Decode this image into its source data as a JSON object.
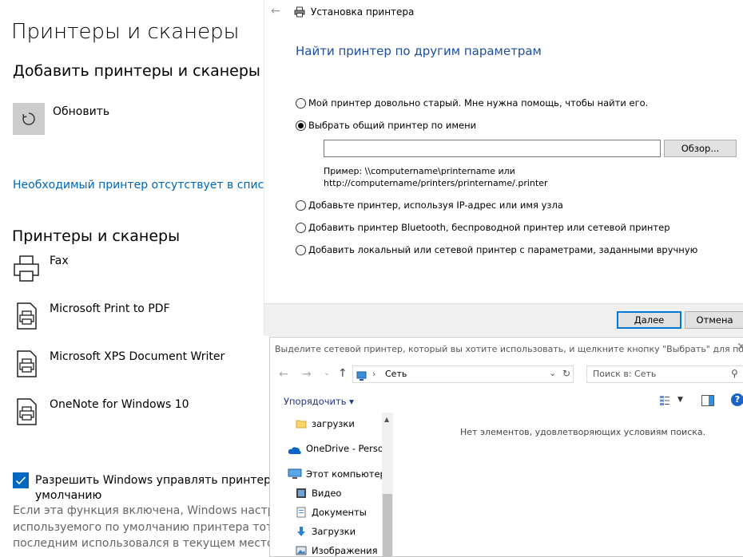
{
  "settings": {
    "title": "Принтеры и сканеры",
    "add_heading": "Добавить принтеры и сканеры",
    "refresh_label": "Обновить",
    "missing_link": "Необходимый принтер отсутствует в списке",
    "list_heading": "Принтеры и сканеры",
    "printers": [
      {
        "name": "Fax",
        "icon": "fax-icon"
      },
      {
        "name": "Microsoft Print to PDF",
        "icon": "printer-document-icon"
      },
      {
        "name": "Microsoft XPS Document Writer",
        "icon": "printer-document-icon"
      },
      {
        "name": "OneNote for Windows 10",
        "icon": "printer-document-icon"
      }
    ],
    "default_checkbox": {
      "checked": true,
      "label_line1": "Разрешить Windows управлять принтером, ис",
      "label_line2": "умолчанию"
    },
    "description_lines": [
      "Если эта функция включена, Windows настроит в",
      "используемого по умолчанию принтера тот принт",
      "последним использовался в текущем местополож"
    ],
    "accent_color": "#0067c0"
  },
  "wizard": {
    "title": "Установка принтера",
    "heading": "Найти принтер по другим параметрам",
    "options": [
      {
        "label": "Мой принтер довольно старый. Мне нужна помощь, чтобы найти его.",
        "selected": false
      },
      {
        "label": "Выбрать общий принтер по имени",
        "selected": true
      },
      {
        "label": "Добавьте принтер, используя IP-адрес или имя узла",
        "selected": false
      },
      {
        "label": "Добавить принтер Bluetooth, беспроводной принтер или сетевой принтер",
        "selected": false
      },
      {
        "label": "Добавить локальный или сетевой принтер с параметрами, заданными вручную",
        "selected": false
      }
    ],
    "printer_name_value": "",
    "browse_label": "Обзор...",
    "example_line1": "Пример: \\\\computername\\printername или",
    "example_line2": "http://computername/printers/printername/.printer",
    "next_label": "Далее",
    "cancel_label": "Отмена"
  },
  "picker": {
    "title": "Выделите сетевой принтер, который вы хотите использовать, и щелкните кнопку \"Выбрать\" для под",
    "address": "Сеть",
    "search_placeholder": "Поиск в: Сеть",
    "organize_label": "Упорядочить ▾",
    "empty_message": "Нет элементов, удовлетворяющих условиям поиска.",
    "nav_items": [
      {
        "label": "загрузки",
        "icon": "folder-icon"
      },
      {
        "label": "OneDrive - Person",
        "icon": "onedrive-icon"
      },
      {
        "label": "Этот компьютер",
        "icon": "computer-icon"
      },
      {
        "label": "Видео",
        "icon": "video-folder-icon"
      },
      {
        "label": "Документы",
        "icon": "documents-folder-icon"
      },
      {
        "label": "Загрузки",
        "icon": "downloads-folder-icon"
      },
      {
        "label": "Изображения",
        "icon": "pictures-folder-icon"
      }
    ]
  }
}
